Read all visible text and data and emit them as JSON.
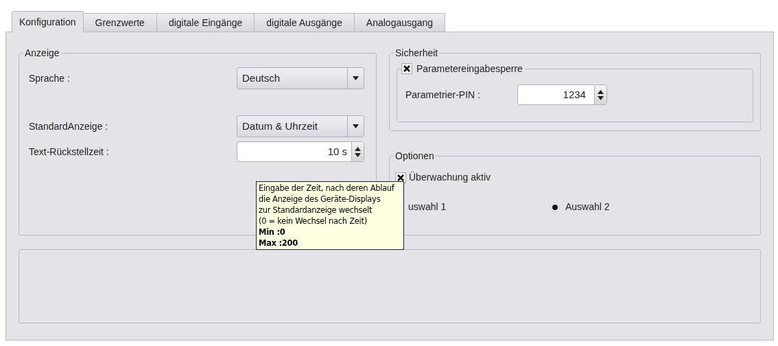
{
  "tabs": [
    {
      "label": "Konfiguration",
      "selected": true
    },
    {
      "label": "Grenzwerte",
      "selected": false
    },
    {
      "label": "digitale Eingänge",
      "selected": false
    },
    {
      "label": "digitale Ausgänge",
      "selected": false
    },
    {
      "label": "Analogausgang",
      "selected": false
    }
  ],
  "anzeige": {
    "title": "Anzeige",
    "sprache": {
      "label": "Sprache :",
      "value": "Deutsch"
    },
    "standard": {
      "label": "StandardAnzeige :",
      "value": "Datum & Uhrzeit"
    },
    "reset": {
      "label": "Text-Rückstellzeit :",
      "value": "10 s"
    }
  },
  "sicherheit": {
    "title": "Sicherheit",
    "lock": {
      "label": "Parametereingabesperre",
      "checked": true
    },
    "pin": {
      "label": "Parametrier-PIN :",
      "value": "1234"
    }
  },
  "optionen": {
    "title": "Optionen",
    "monitor": {
      "label": "Überwachung aktiv",
      "checked": true
    },
    "radios": [
      {
        "label": "uswahl 1",
        "selected": false
      },
      {
        "label": "Auswahl 2",
        "selected": true
      }
    ]
  },
  "tooltip": {
    "lines": [
      "Eingabe der Zeit, nach deren Ablauf",
      "die Anzeige des Geräte-Displays",
      "zur Standardanzeige wechselt",
      "(0 = kein Wechsel nach Zeit)",
      "**Min :0**",
      "**Max :200**"
    ]
  }
}
